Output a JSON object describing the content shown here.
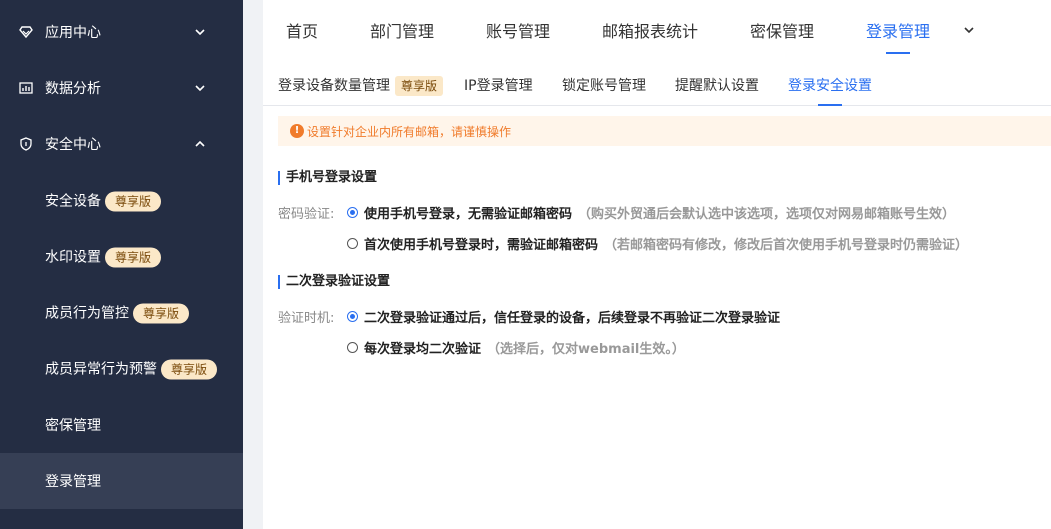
{
  "sidebar": {
    "groups": [
      {
        "label": "应用中心",
        "icon": "diamond-icon",
        "expanded": false
      },
      {
        "label": "数据分析",
        "icon": "chart-icon",
        "expanded": false
      },
      {
        "label": "安全中心",
        "icon": "shield-icon",
        "expanded": true
      }
    ],
    "items": [
      {
        "label": "安全设备",
        "badge": "尊享版"
      },
      {
        "label": "水印设置",
        "badge": "尊享版"
      },
      {
        "label": "成员行为管控",
        "badge": "尊享版"
      },
      {
        "label": "成员异常行为预警",
        "badge": "尊享版"
      },
      {
        "label": "密保管理",
        "badge": ""
      },
      {
        "label": "登录管理",
        "badge": "",
        "active": true
      }
    ]
  },
  "topnav": {
    "tabs": [
      "首页",
      "部门管理",
      "账号管理",
      "邮箱报表统计",
      "密保管理",
      "登录管理"
    ],
    "active_index": 5,
    "more_icon": "chevron-down-icon"
  },
  "subnav": {
    "tabs": [
      {
        "label": "登录设备数量管理",
        "badge": "尊享版"
      },
      {
        "label": "IP登录管理",
        "badge": ""
      },
      {
        "label": "锁定账号管理",
        "badge": ""
      },
      {
        "label": "提醒默认设置",
        "badge": ""
      },
      {
        "label": "登录安全设置",
        "badge": "",
        "active": true
      }
    ]
  },
  "notice": {
    "icon": "warning-icon",
    "text": "设置针对企业内所有邮箱，请谨慎操作"
  },
  "phone_login": {
    "title": "手机号登录设置",
    "field_label": "密码验证:",
    "options": [
      {
        "label": "使用手机号登录，无需验证邮箱密码",
        "hint": "（购买外贸通后会默认选中该选项，选项仅对网易邮箱账号生效）",
        "checked": true
      },
      {
        "label": "首次使用手机号登录时，需验证邮箱密码",
        "hint": "（若邮箱密码有修改，修改后首次使用手机号登录时仍需验证）",
        "checked": false
      }
    ]
  },
  "second_verify": {
    "title": "二次登录验证设置",
    "field_label": "验证时机:",
    "options": [
      {
        "label": "二次登录验证通过后，信任登录的设备，后续登录不再验证二次登录验证",
        "hint": "",
        "checked": true
      },
      {
        "label": "每次登录均二次验证",
        "hint": "（选择后，仅对webmail生效。）",
        "checked": false
      }
    ]
  },
  "colors": {
    "sidebar_bg": "#242d43",
    "sidebar_active": "#363f55",
    "accent": "#2a6ff0",
    "badge_bg": "#fbe8c8",
    "warning": "#f07b2b"
  }
}
